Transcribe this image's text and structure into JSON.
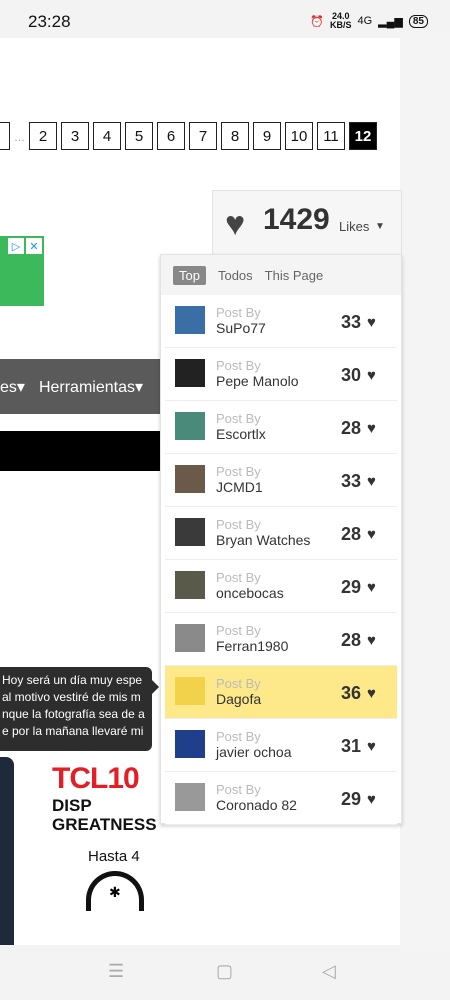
{
  "status": {
    "time": "23:28",
    "speed_value": "24.0",
    "speed_unit": "KB/S",
    "network": "4G",
    "battery": "85"
  },
  "pager": {
    "pages": [
      "2",
      "3",
      "4",
      "5",
      "6",
      "7",
      "8",
      "9",
      "10",
      "11"
    ],
    "current": "12"
  },
  "nav_menu": {
    "partial_item": "es",
    "item": "Herramientas"
  },
  "tooltip": {
    "lines": [
      "Hoy será un día muy espe",
      "al motivo vestiré de mis m",
      "nque la fotografía sea de a",
      "e por la mañana llevaré mi"
    ]
  },
  "tcl_ad": {
    "brand": "TCL",
    "brand_suffix": "10",
    "line1": "DISP",
    "line2": "GREATNESS",
    "hasta": "Hasta 4"
  },
  "likes": {
    "count": "1429",
    "label": "Likes"
  },
  "tabs": [
    "Top",
    "Todos",
    "This Page"
  ],
  "post_by_label": "Post By",
  "top_posts": [
    {
      "user": "SuPo77",
      "likes": "33",
      "thumb_color": "#3a6ea5"
    },
    {
      "user": "Pepe Manolo",
      "likes": "30",
      "thumb_color": "#222222"
    },
    {
      "user": "Escortlx",
      "likes": "28",
      "thumb_color": "#4a8a7a"
    },
    {
      "user": "JCMD1",
      "likes": "33",
      "thumb_color": "#6b5a4a"
    },
    {
      "user": "Bryan Watches",
      "likes": "28",
      "thumb_color": "#3a3a3a"
    },
    {
      "user": "oncebocas",
      "likes": "29",
      "thumb_color": "#5a5a4a"
    },
    {
      "user": "Ferran1980",
      "likes": "28",
      "thumb_color": "#8a8a8a"
    },
    {
      "user": "Dagofa",
      "likes": "36",
      "thumb_color": "#f2d24a",
      "highlighted": true
    },
    {
      "user": "javier ochoa",
      "likes": "31",
      "thumb_color": "#1f3f8a"
    },
    {
      "user": "Coronado 82",
      "likes": "29",
      "thumb_color": "#999999"
    }
  ]
}
